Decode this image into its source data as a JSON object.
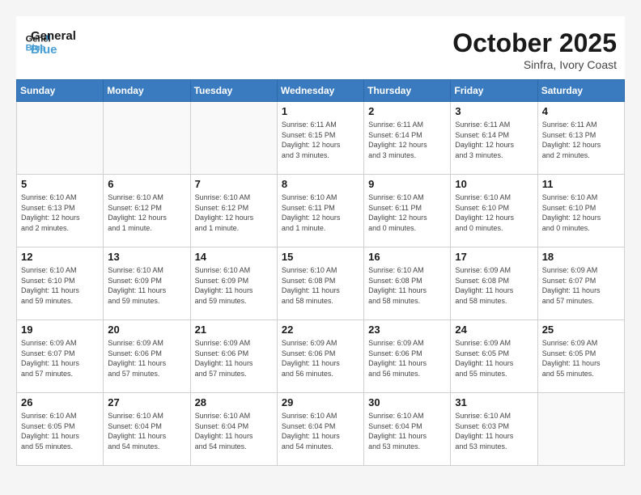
{
  "header": {
    "logo_line1": "General",
    "logo_line2": "Blue",
    "month": "October 2025",
    "location": "Sinfra, Ivory Coast"
  },
  "weekdays": [
    "Sunday",
    "Monday",
    "Tuesday",
    "Wednesday",
    "Thursday",
    "Friday",
    "Saturday"
  ],
  "weeks": [
    [
      {
        "day": "",
        "info": ""
      },
      {
        "day": "",
        "info": ""
      },
      {
        "day": "",
        "info": ""
      },
      {
        "day": "1",
        "info": "Sunrise: 6:11 AM\nSunset: 6:15 PM\nDaylight: 12 hours\nand 3 minutes."
      },
      {
        "day": "2",
        "info": "Sunrise: 6:11 AM\nSunset: 6:14 PM\nDaylight: 12 hours\nand 3 minutes."
      },
      {
        "day": "3",
        "info": "Sunrise: 6:11 AM\nSunset: 6:14 PM\nDaylight: 12 hours\nand 3 minutes."
      },
      {
        "day": "4",
        "info": "Sunrise: 6:11 AM\nSunset: 6:13 PM\nDaylight: 12 hours\nand 2 minutes."
      }
    ],
    [
      {
        "day": "5",
        "info": "Sunrise: 6:10 AM\nSunset: 6:13 PM\nDaylight: 12 hours\nand 2 minutes."
      },
      {
        "day": "6",
        "info": "Sunrise: 6:10 AM\nSunset: 6:12 PM\nDaylight: 12 hours\nand 1 minute."
      },
      {
        "day": "7",
        "info": "Sunrise: 6:10 AM\nSunset: 6:12 PM\nDaylight: 12 hours\nand 1 minute."
      },
      {
        "day": "8",
        "info": "Sunrise: 6:10 AM\nSunset: 6:11 PM\nDaylight: 12 hours\nand 1 minute."
      },
      {
        "day": "9",
        "info": "Sunrise: 6:10 AM\nSunset: 6:11 PM\nDaylight: 12 hours\nand 0 minutes."
      },
      {
        "day": "10",
        "info": "Sunrise: 6:10 AM\nSunset: 6:10 PM\nDaylight: 12 hours\nand 0 minutes."
      },
      {
        "day": "11",
        "info": "Sunrise: 6:10 AM\nSunset: 6:10 PM\nDaylight: 12 hours\nand 0 minutes."
      }
    ],
    [
      {
        "day": "12",
        "info": "Sunrise: 6:10 AM\nSunset: 6:10 PM\nDaylight: 11 hours\nand 59 minutes."
      },
      {
        "day": "13",
        "info": "Sunrise: 6:10 AM\nSunset: 6:09 PM\nDaylight: 11 hours\nand 59 minutes."
      },
      {
        "day": "14",
        "info": "Sunrise: 6:10 AM\nSunset: 6:09 PM\nDaylight: 11 hours\nand 59 minutes."
      },
      {
        "day": "15",
        "info": "Sunrise: 6:10 AM\nSunset: 6:08 PM\nDaylight: 11 hours\nand 58 minutes."
      },
      {
        "day": "16",
        "info": "Sunrise: 6:10 AM\nSunset: 6:08 PM\nDaylight: 11 hours\nand 58 minutes."
      },
      {
        "day": "17",
        "info": "Sunrise: 6:09 AM\nSunset: 6:08 PM\nDaylight: 11 hours\nand 58 minutes."
      },
      {
        "day": "18",
        "info": "Sunrise: 6:09 AM\nSunset: 6:07 PM\nDaylight: 11 hours\nand 57 minutes."
      }
    ],
    [
      {
        "day": "19",
        "info": "Sunrise: 6:09 AM\nSunset: 6:07 PM\nDaylight: 11 hours\nand 57 minutes."
      },
      {
        "day": "20",
        "info": "Sunrise: 6:09 AM\nSunset: 6:06 PM\nDaylight: 11 hours\nand 57 minutes."
      },
      {
        "day": "21",
        "info": "Sunrise: 6:09 AM\nSunset: 6:06 PM\nDaylight: 11 hours\nand 57 minutes."
      },
      {
        "day": "22",
        "info": "Sunrise: 6:09 AM\nSunset: 6:06 PM\nDaylight: 11 hours\nand 56 minutes."
      },
      {
        "day": "23",
        "info": "Sunrise: 6:09 AM\nSunset: 6:06 PM\nDaylight: 11 hours\nand 56 minutes."
      },
      {
        "day": "24",
        "info": "Sunrise: 6:09 AM\nSunset: 6:05 PM\nDaylight: 11 hours\nand 55 minutes."
      },
      {
        "day": "25",
        "info": "Sunrise: 6:09 AM\nSunset: 6:05 PM\nDaylight: 11 hours\nand 55 minutes."
      }
    ],
    [
      {
        "day": "26",
        "info": "Sunrise: 6:10 AM\nSunset: 6:05 PM\nDaylight: 11 hours\nand 55 minutes."
      },
      {
        "day": "27",
        "info": "Sunrise: 6:10 AM\nSunset: 6:04 PM\nDaylight: 11 hours\nand 54 minutes."
      },
      {
        "day": "28",
        "info": "Sunrise: 6:10 AM\nSunset: 6:04 PM\nDaylight: 11 hours\nand 54 minutes."
      },
      {
        "day": "29",
        "info": "Sunrise: 6:10 AM\nSunset: 6:04 PM\nDaylight: 11 hours\nand 54 minutes."
      },
      {
        "day": "30",
        "info": "Sunrise: 6:10 AM\nSunset: 6:04 PM\nDaylight: 11 hours\nand 53 minutes."
      },
      {
        "day": "31",
        "info": "Sunrise: 6:10 AM\nSunset: 6:03 PM\nDaylight: 11 hours\nand 53 minutes."
      },
      {
        "day": "",
        "info": ""
      }
    ]
  ]
}
